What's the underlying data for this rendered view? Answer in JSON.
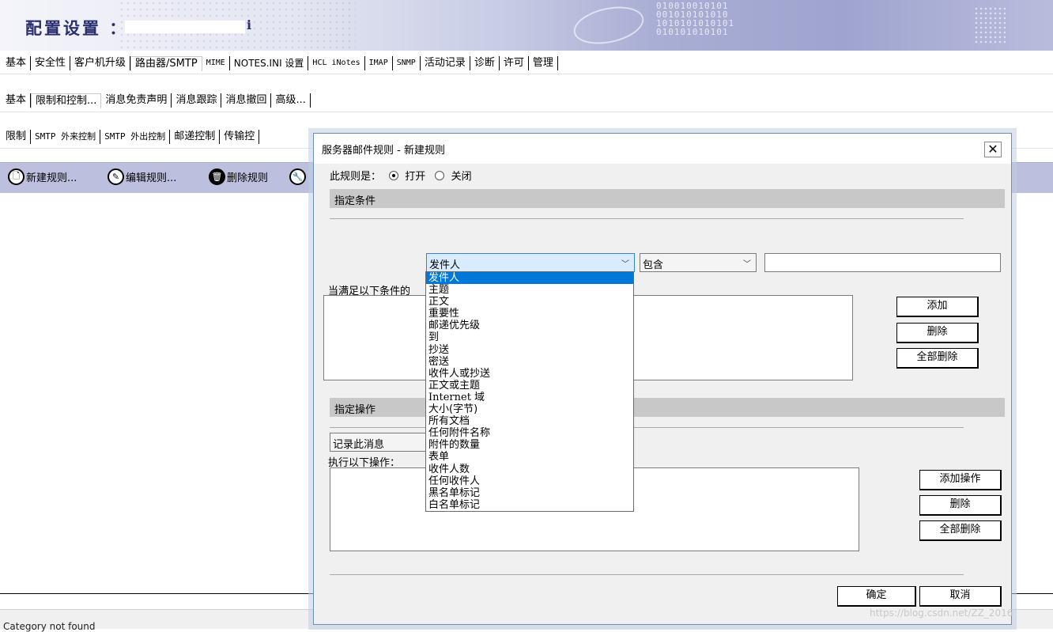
{
  "banner": {
    "title": "配置设置 ：",
    "title_tail": "i",
    "binary": "010010010101\n001010101010\n1010101010101\n010101010101"
  },
  "tabs_row1": [
    "基本",
    "安全性",
    "客户机升级",
    "路由器/SMTP",
    "MIME",
    "NOTES.INI 设置",
    "HCL iNotes",
    "IMAP",
    "SNMP",
    "活动记录",
    "诊断",
    "许可",
    "管理"
  ],
  "tabs_row2": [
    "基本",
    "限制和控制...",
    "消息免责声明",
    "消息跟踪",
    "消息撤回",
    "高级..."
  ],
  "tabs_row3": [
    "限制",
    "SMTP 外来控制",
    "SMTP 外出控制",
    "邮递控制",
    "传输控"
  ],
  "actions": {
    "new_rule": "新建规则...",
    "edit_rule": "编辑规则...",
    "delete_rule": "删除规则"
  },
  "status": {
    "text": "Category not found"
  },
  "dialog": {
    "title": "服务器邮件规则 - 新建规则",
    "close": "✕",
    "rule_is_label": "此规则是：",
    "radio_on": "打开",
    "radio_off": "关闭",
    "section_condition": "指定条件",
    "field_combo": "发件人",
    "op_combo": "包含",
    "conditions_label": "当满足以下条件的",
    "add": "添加",
    "delete": "删除",
    "delete_all": "全部删除",
    "section_action": "指定操作",
    "action_combo": "记录此消息",
    "execute_label": "执行以下操作：",
    "add_action": "添加操作",
    "delete2": "删除",
    "delete_all2": "全部删除",
    "ok": "确定",
    "cancel": "取消",
    "dropdown_options": [
      "发件人",
      "主题",
      "正文",
      "重要性",
      "邮递优先级",
      "到",
      "抄送",
      "密送",
      "收件人或抄送",
      "正文或主题",
      "Internet 域",
      "大小(字节)",
      "所有文档",
      "任何附件名称",
      "附件的数量",
      "表单",
      "收件人数",
      "任何收件人",
      "黑名单标记",
      "白名单标记"
    ]
  },
  "watermark": "https://blog.csdn.net/ZZ_2016"
}
